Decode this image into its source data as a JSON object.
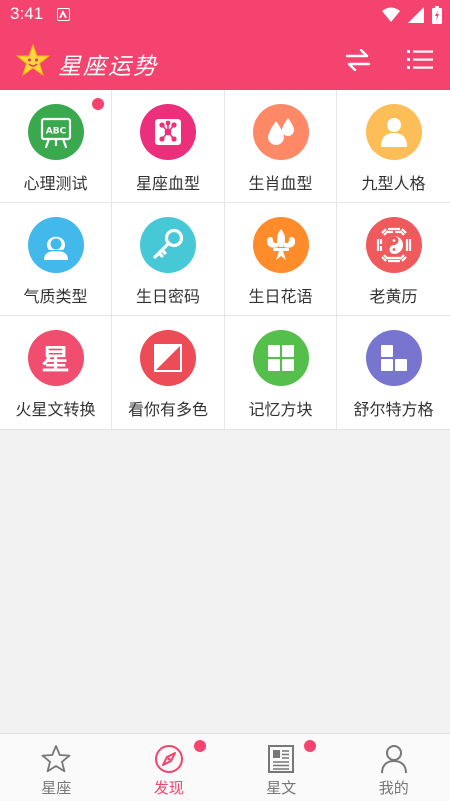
{
  "status_bar": {
    "time": "3:41"
  },
  "header": {
    "title": "星座运势"
  },
  "colors": {
    "brand": "#f4436e",
    "badge": "#f4436e"
  },
  "tools": [
    {
      "label": "心理测试",
      "icon": "abc-board-icon",
      "color": "#3aa84c",
      "badge": true
    },
    {
      "label": "星座血型",
      "icon": "constellation-icon",
      "color": "#ec2f7a",
      "badge": false
    },
    {
      "label": "生肖血型",
      "icon": "blood-drops-icon",
      "color": "#ff8866",
      "badge": false
    },
    {
      "label": "九型人格",
      "icon": "person-icon",
      "color": "#fdbe57",
      "badge": false
    },
    {
      "label": "气质类型",
      "icon": "woman-icon",
      "color": "#43b8ea",
      "badge": false
    },
    {
      "label": "生日密码",
      "icon": "key-icon",
      "color": "#47c8d6",
      "badge": false
    },
    {
      "label": "生日花语",
      "icon": "fleur-de-lis-icon",
      "color": "#fe8c2b",
      "badge": false
    },
    {
      "label": "老黄历",
      "icon": "bagua-icon",
      "color": "#f05a5c",
      "badge": false
    },
    {
      "label": "火星文转换",
      "icon": "star-char-icon",
      "color": "#f14d6e",
      "badge": false,
      "glyph": "星"
    },
    {
      "label": "看你有多色",
      "icon": "color-square-icon",
      "color": "#ed4b55",
      "badge": false
    },
    {
      "label": "记忆方块",
      "icon": "four-squares-icon",
      "color": "#54bf4b",
      "badge": false
    },
    {
      "label": "舒尔特方格",
      "icon": "blocks-icon",
      "color": "#7775cf",
      "badge": false
    }
  ],
  "bottom_nav": [
    {
      "label": "星座",
      "icon": "star-icon",
      "active": false,
      "badge": false
    },
    {
      "label": "发现",
      "icon": "compass-icon",
      "active": true,
      "badge": true
    },
    {
      "label": "星文",
      "icon": "newspaper-icon",
      "active": false,
      "badge": true
    },
    {
      "label": "我的",
      "icon": "user-icon",
      "active": false,
      "badge": false
    }
  ]
}
